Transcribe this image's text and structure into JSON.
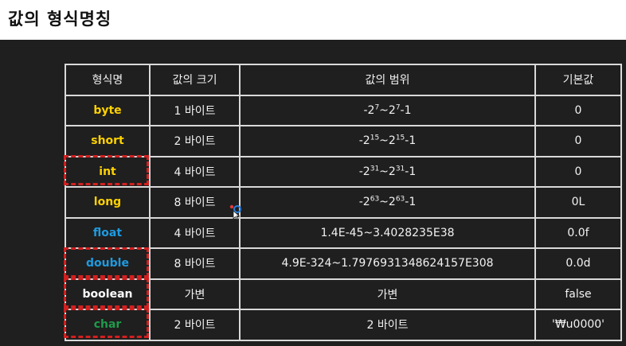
{
  "page": {
    "title": "값의 형식명칭"
  },
  "table": {
    "headers": [
      "형식명",
      "값의 크기",
      "값의 범위",
      "기본값"
    ],
    "rows": [
      {
        "name": "byte",
        "color": "#ffd200",
        "size": "1 바이트",
        "range_min": {
          "base": "-2",
          "exp": "7"
        },
        "range_max": {
          "base": "~2",
          "exp": "7",
          "tail": "-1"
        },
        "default": "0"
      },
      {
        "name": "short",
        "color": "#ffd200",
        "size": "2 바이트",
        "range_min": {
          "base": "-2",
          "exp": "15"
        },
        "range_max": {
          "base": "~2",
          "exp": "15",
          "tail": "-1"
        },
        "default": "0"
      },
      {
        "name": "int",
        "color": "#ffd200",
        "size": "4 바이트",
        "range_min": {
          "base": "-2",
          "exp": "31"
        },
        "range_max": {
          "base": "~2",
          "exp": "31",
          "tail": "-1"
        },
        "default": "0"
      },
      {
        "name": "long",
        "color": "#ffd200",
        "size": "8 바이트",
        "range_min": {
          "base": "-2",
          "exp": "63"
        },
        "range_max": {
          "base": "~2",
          "exp": "63",
          "tail": "-1"
        },
        "default": "0L"
      },
      {
        "name": "float",
        "color": "#1e9be0",
        "size": "4 바이트",
        "range": "1.4E-45~3.4028235E38",
        "default": "0.0f"
      },
      {
        "name": "double",
        "color": "#1e9be0",
        "size": "8 바이트",
        "range": "4.9E-324~1.7976931348624157E308",
        "default": "0.0d"
      },
      {
        "name": "boolean",
        "color": "#ffffff",
        "size": "가변",
        "range": "가변",
        "default": "false"
      },
      {
        "name": "char",
        "color": "#1f9a4a",
        "size": "2 바이트",
        "range": "2 바이트",
        "default": "'₩u0000'"
      }
    ]
  },
  "colors": {
    "slide_background": "#1f1f1f",
    "grid": "#d9d9d9",
    "highlight_border": "#d21f1f",
    "integer_types": "#ffd200",
    "float_types": "#1e9be0",
    "char_type": "#1f9a4a"
  },
  "highlighted_types": [
    "int",
    "double",
    "boolean",
    "char"
  ]
}
